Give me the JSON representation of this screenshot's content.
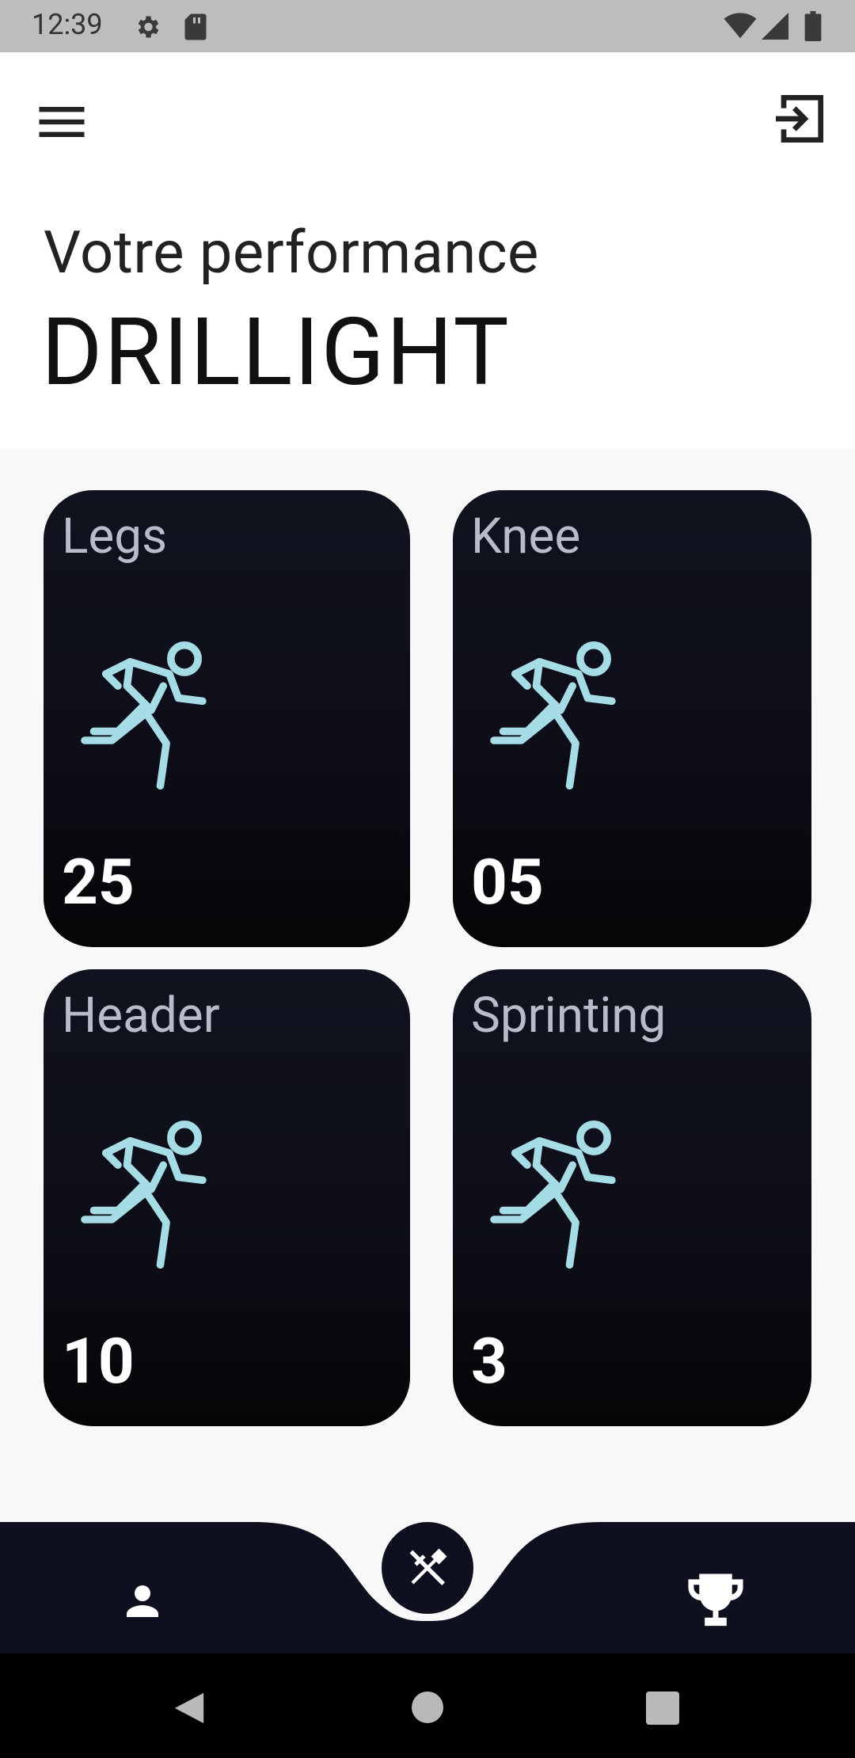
{
  "status_bar": {
    "time": "12:39",
    "icons": [
      "gear-icon",
      "sd-card-icon",
      "wifi-icon",
      "signal-icon",
      "battery-icon"
    ]
  },
  "app_bar": {
    "menu_icon": "menu-icon",
    "logout_icon": "logout-icon"
  },
  "header": {
    "subtitle": "Votre performance",
    "title": "DRILLIGHT"
  },
  "cards": [
    {
      "label": "Legs",
      "value": "25",
      "icon": "running-icon"
    },
    {
      "label": "Knee",
      "value": "05",
      "icon": "running-icon"
    },
    {
      "label": "Header",
      "value": "10",
      "icon": "running-icon"
    },
    {
      "label": "Sprinting",
      "value": "3",
      "icon": "running-icon"
    }
  ],
  "bottom_nav": {
    "items": [
      {
        "name": "profile",
        "icon": "person-icon"
      },
      {
        "name": "tools",
        "icon": "hammer-wrench-icon"
      },
      {
        "name": "rankings",
        "icon": "trophy-icon"
      }
    ]
  },
  "colors": {
    "card_bg": "#0d0e18",
    "card_label": "#b8bcc8",
    "icon_accent": "#a6dce6",
    "nav_bg": "#0e1020"
  }
}
